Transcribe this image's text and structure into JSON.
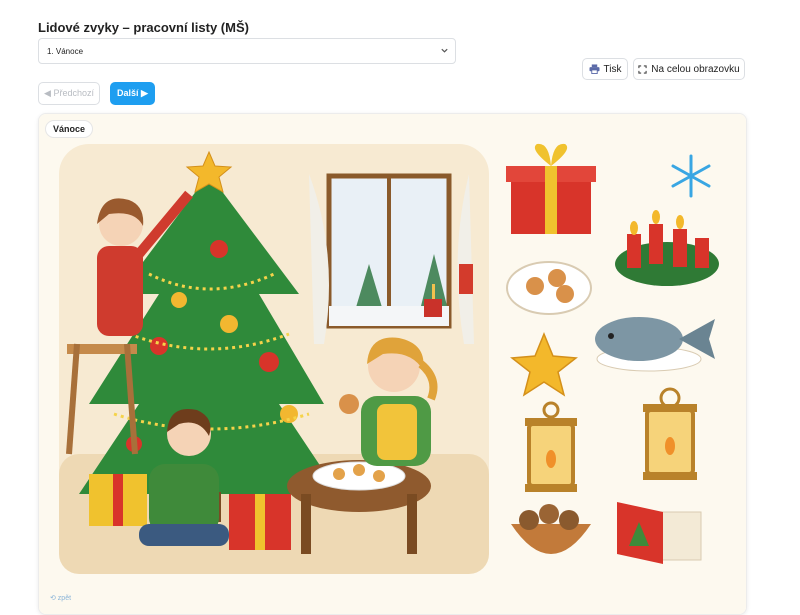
{
  "page": {
    "title": "Lidové zvyky – pracovní listy (MŠ)"
  },
  "worksheet_select": {
    "selected": "1. Vánoce"
  },
  "toolbar": {
    "print_label": "Tisk",
    "fullscreen_label": "Na celou obrazovku"
  },
  "pager": {
    "prev_label": "◀ Předchozí",
    "next_label": "Další ▶"
  },
  "card": {
    "badge": "Vánoce"
  },
  "footer": {
    "link_text": "⟲ zpět"
  },
  "colors": {
    "accent": "#1e9ef0",
    "disabled_text": "#b8bcc2",
    "sheet_bg": "#fdf9ef"
  },
  "icons": [
    "chevron-down-icon",
    "printer-icon",
    "fullscreen-icon"
  ],
  "illustration_items": [
    "gift",
    "snowflake",
    "cookies-plate",
    "advent-wreath",
    "star",
    "fish",
    "lantern",
    "lantern",
    "walnuts-bowl",
    "christmas-card"
  ]
}
